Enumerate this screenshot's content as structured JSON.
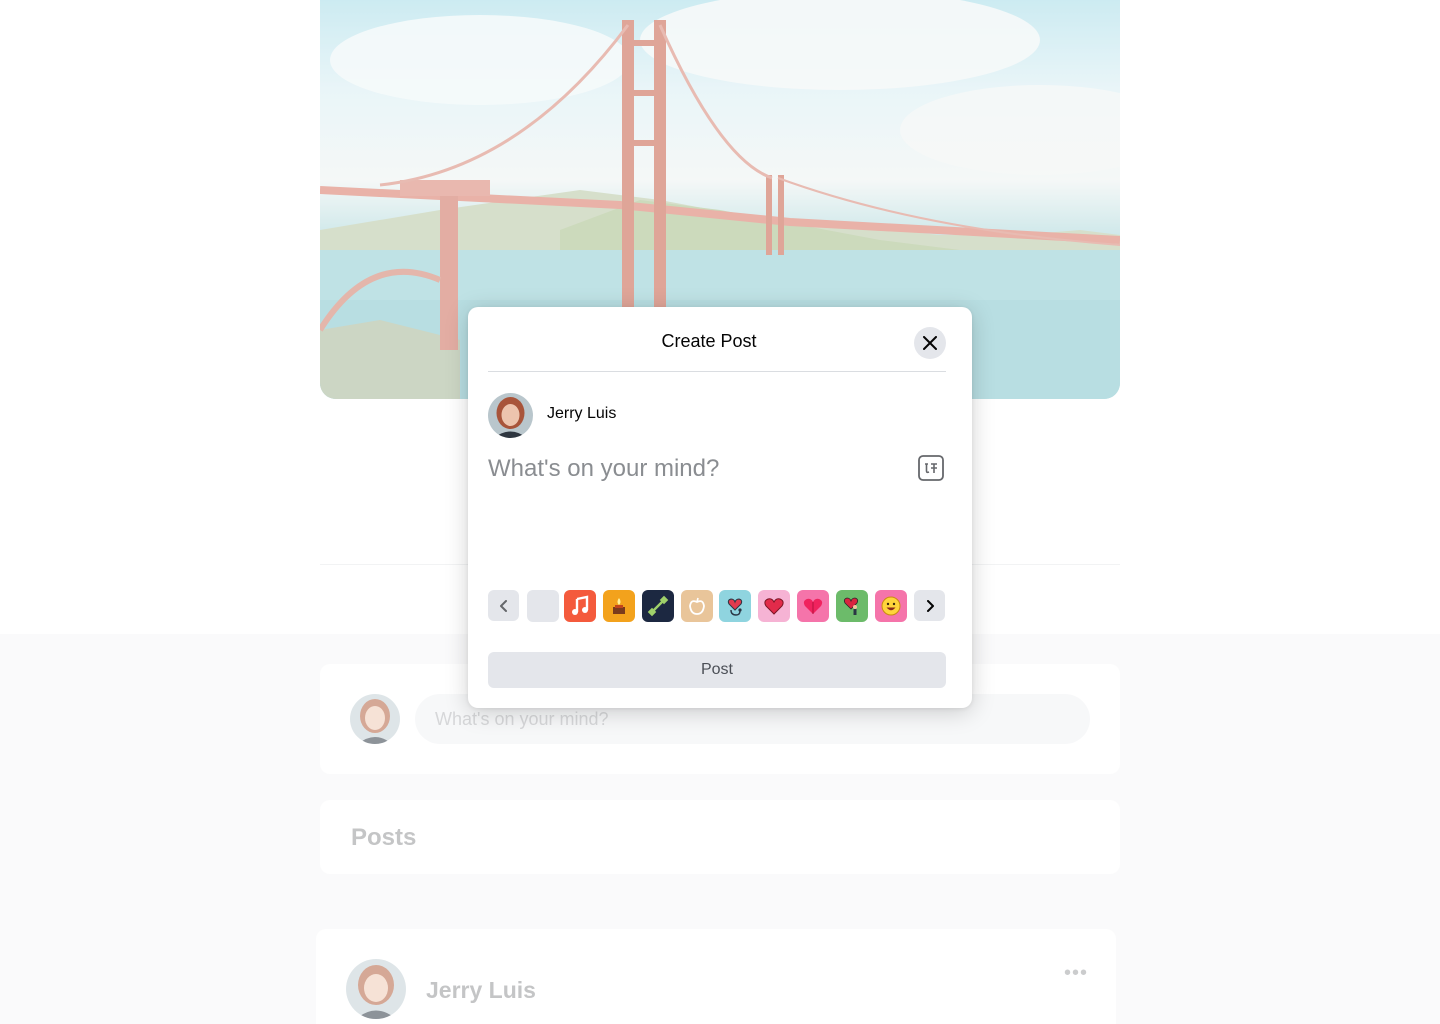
{
  "modal": {
    "title": "Create Post",
    "user_name": "Jerry Luis",
    "placeholder": "What's on your mind?",
    "post_label": "Post",
    "stickers": [
      "blank",
      "music-note-icon",
      "candle-lantern-icon",
      "dumbbell-icon",
      "apple-icon",
      "heart-stethoscope-icon",
      "heart-icon",
      "pink-heart-icon",
      "heart-with-figure-icon",
      "smiley-icon"
    ]
  },
  "composer": {
    "placeholder": "What's on your mind?"
  },
  "posts_section": {
    "title": "Posts"
  },
  "post": {
    "author": "Jerry Luis",
    "more": "•••"
  },
  "colors": {
    "modal_bg": "#ffffff",
    "button_grey": "#e4e6eb",
    "page_bg": "#f6f7f8"
  }
}
